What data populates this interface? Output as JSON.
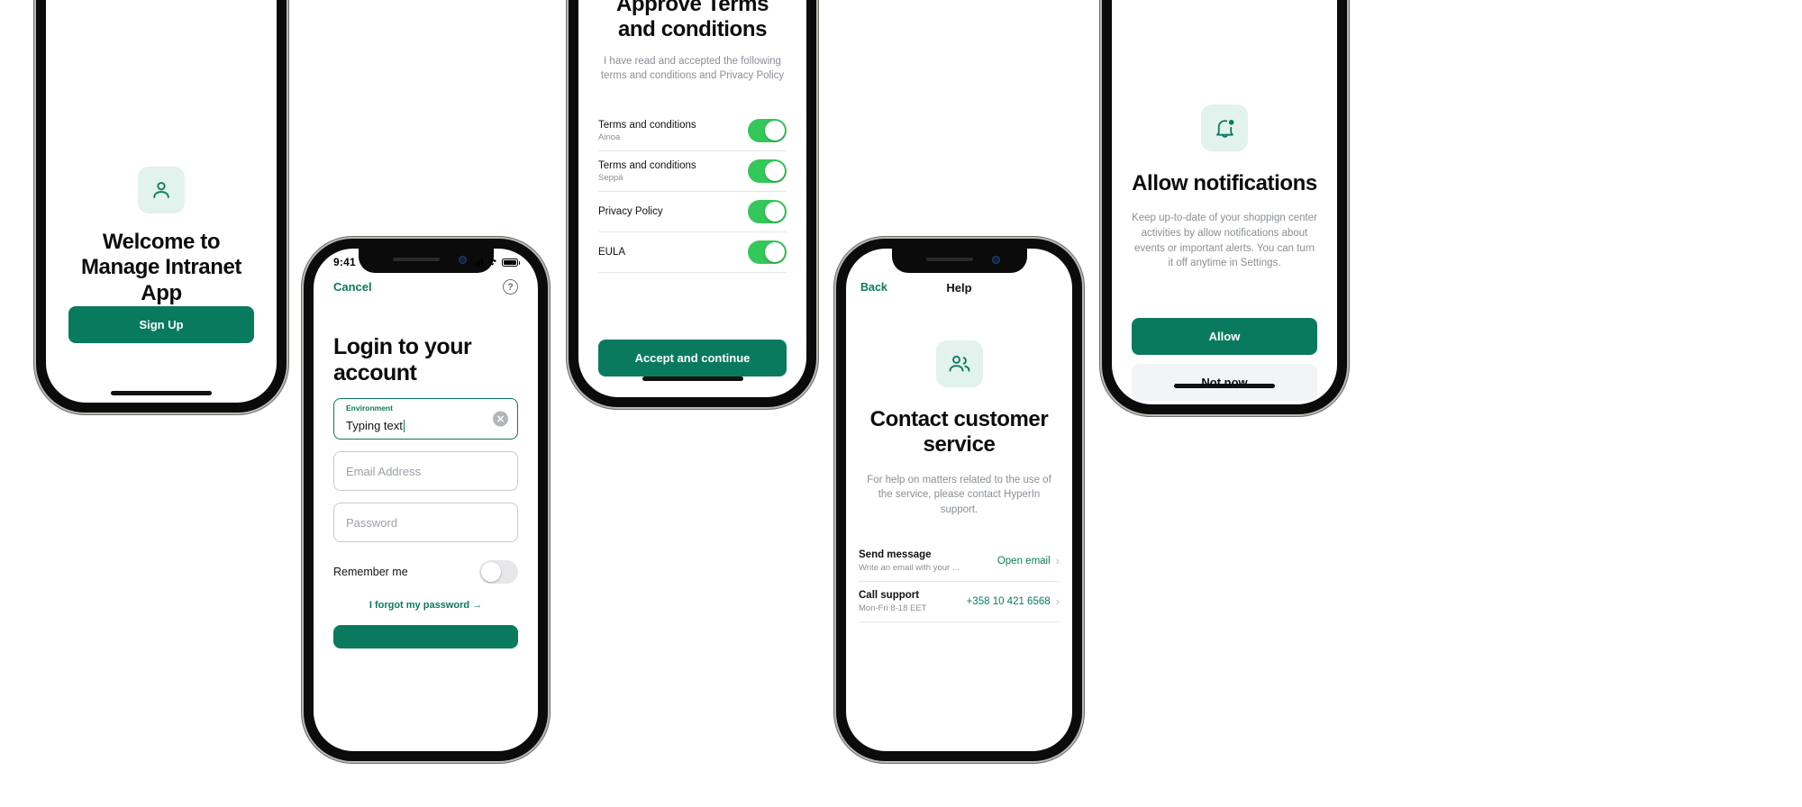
{
  "screens": {
    "welcome": {
      "icon": "user-icon",
      "title": "Welcome to Manage Intranet App",
      "signup_label": "Sign Up"
    },
    "login": {
      "status": {
        "time": "9:41"
      },
      "cancel_label": "Cancel",
      "help_icon_label": "?",
      "title": "Login to your account",
      "environment": {
        "label": "Environment",
        "value": "Typing text"
      },
      "email": {
        "placeholder": "Email Address",
        "value": ""
      },
      "password": {
        "placeholder": "Password",
        "value": ""
      },
      "remember_label": "Remember me",
      "remember_on": false,
      "forgot_label": "I forgot my password  →"
    },
    "terms": {
      "title": "Approve Terms and conditions",
      "subtitle": "I have read and accepted the following terms and conditions and Privacy Policy",
      "rows": [
        {
          "name": "Terms and conditions",
          "sub": "Ainoa",
          "on": true
        },
        {
          "name": "Terms and conditions",
          "sub": "Seppä",
          "on": true
        },
        {
          "name": "Privacy Policy",
          "sub": "",
          "on": true
        },
        {
          "name": "EULA",
          "sub": "",
          "on": true
        }
      ],
      "accept_label": "Accept and continue"
    },
    "help": {
      "back_label": "Back",
      "nav_title": "Help",
      "icon": "people-icon",
      "title": "Contact customer service",
      "subtitle": "For help on matters related to the use of the service, please contact HyperIn support.",
      "rows": [
        {
          "name": "Send message",
          "sub": "Write an email with your ...",
          "action": "Open email"
        },
        {
          "name": "Call support",
          "sub": "Mon-Fri 8-18 EET",
          "action": "+358 10 421 6568"
        }
      ]
    },
    "notifications": {
      "icon": "bell-icon",
      "title": "Allow notifications",
      "subtitle": "Keep up-to-date of your shoppign center activities by allow notifications about events or important alerts. You can turn it off anytime in Settings.",
      "allow_label": "Allow",
      "not_now_label": "Not now"
    }
  },
  "colors": {
    "brand_green": "#0a7a5e",
    "toggle_green": "#34c759",
    "icon_tile_bg": "#e2f2ec",
    "muted_text": "#8a8f95"
  }
}
